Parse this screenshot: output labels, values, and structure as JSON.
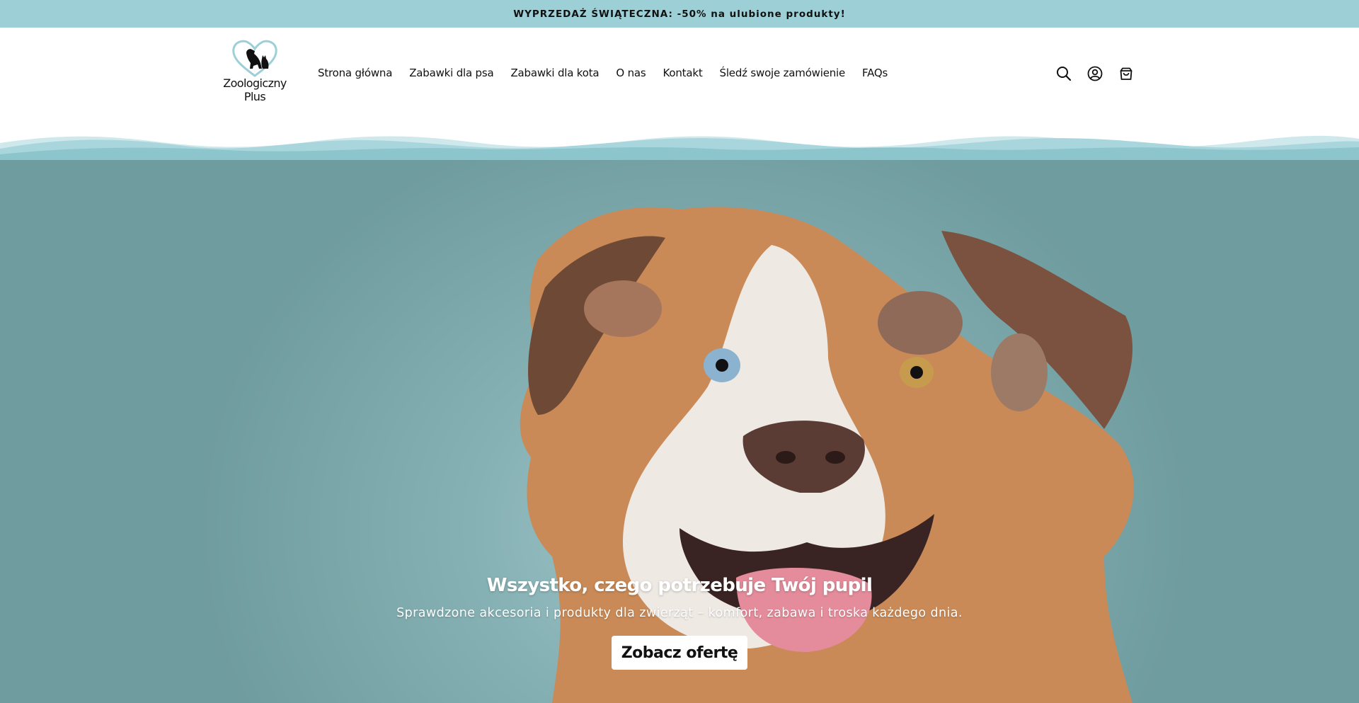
{
  "announcement": {
    "text": "WYPRZEDAŻ ŚWIĄTECZNA: -50% na ulubione produkty!"
  },
  "brand": {
    "name_line1": "Zoologiczny",
    "name_line2": "Plus"
  },
  "nav": {
    "items": [
      {
        "label": "Strona główna"
      },
      {
        "label": "Zabawki dla psa"
      },
      {
        "label": "Zabawki dla kota"
      },
      {
        "label": "O nas"
      },
      {
        "label": "Kontakt"
      },
      {
        "label": "Śledź swoje zamówienie"
      },
      {
        "label": "FAQs"
      }
    ]
  },
  "header_icons": [
    "search-icon",
    "account-icon",
    "cart-icon"
  ],
  "hero": {
    "title": "Wszystko, czego potrzebuje Twój pupil",
    "subtitle": "Sprawdzone akcesoria i produkty dla zwierząt – komfort, zabawa i troska każdego dnia.",
    "cta_label": "Zobacz ofertę",
    "image": "dog-photo"
  },
  "colors": {
    "announcement_bg": "#9dd0d6",
    "wave": "#8cc5cc",
    "hero_bg": "#86b1b4",
    "button_bg": "#ffffff"
  }
}
